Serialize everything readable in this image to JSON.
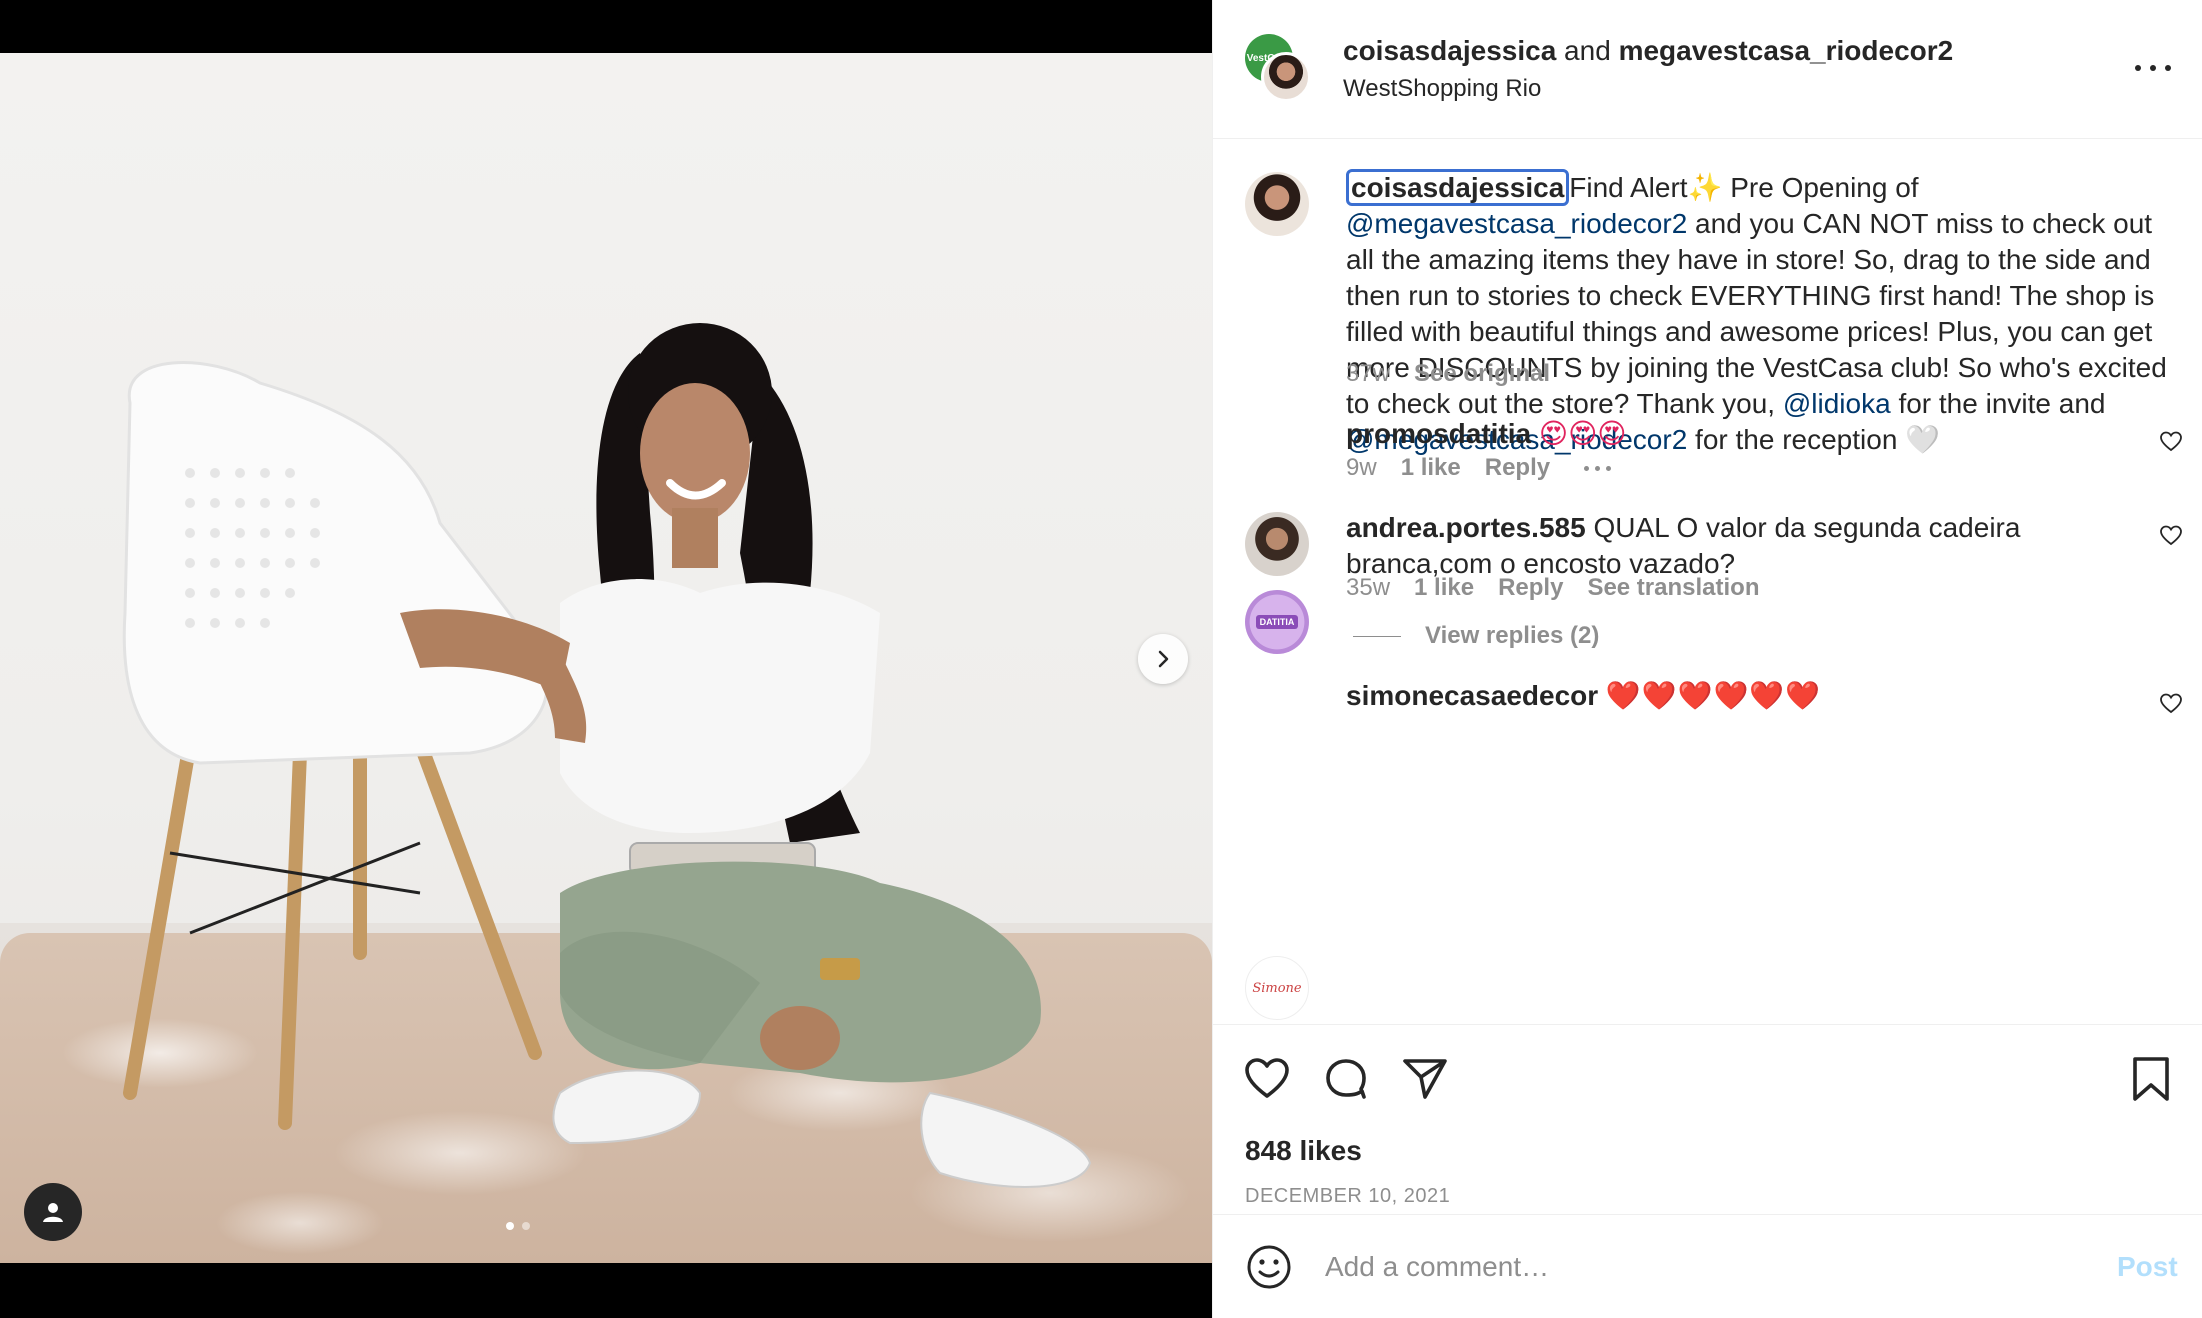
{
  "header": {
    "user1": "coisasdajessica",
    "joiner": " and ",
    "user2": "megavestcasa_riodecor2",
    "location": "WestShopping Rio",
    "collab_badge": "VestCasa"
  },
  "caption": {
    "username": "coisasdajessica",
    "part1": "Find Alert",
    "sparkle": "✨",
    "part2": " Pre Opening of ",
    "mention1": "@megavestcasa_riodecor2",
    "part3": " and you CAN NOT miss to check out all the amazing items they have in store! So, drag to the side and then run to stories to check EVERYTHING first hand! The shop is filled with beautiful things and awesome prices! Plus, you can get more DISCOUNTS by joining the VestCasa club! So who's excited to check out the store? Thank you, ",
    "mention2": "@lidioka",
    "part4": " for the invite and ",
    "mention3": "@megavestcasa_riodecor2",
    "part5": " for the reception ",
    "heart": "🤍",
    "time": "37w",
    "see_original": "See original"
  },
  "comments": [
    {
      "username": "promosdatitia",
      "text": "😍😍😍",
      "avatar_text": "DATITIA",
      "time": "9w",
      "likes": "1 like",
      "reply": "Reply"
    },
    {
      "username": "andrea.portes.585",
      "text": "QUAL O valor da segunda cadeira branca,com o encosto vazado?",
      "time": "35w",
      "likes": "1 like",
      "reply": "Reply",
      "translation": "See translation",
      "view_replies": "View replies (2)"
    },
    {
      "username": "simonecasaedecor",
      "text": "❤️❤️❤️❤️❤️❤️",
      "avatar_text": "Simone"
    }
  ],
  "actions": {
    "likes": "848 likes",
    "date": "DECEMBER 10, 2021"
  },
  "comment_box": {
    "placeholder": "Add a comment…",
    "post": "Post"
  },
  "icons": {
    "more": "more-horizontal-icon",
    "next": "chevron-right-icon",
    "tags": "user-tag-icon",
    "like": "heart-icon",
    "comment": "comment-bubble-icon",
    "share": "paper-plane-icon",
    "save": "bookmark-icon",
    "emoji": "smiley-icon"
  },
  "colors": {
    "link": "#00376b",
    "muted": "#8e8e8e",
    "post_disabled": "#b2dffc",
    "focus_ring": "#3b6fd1"
  }
}
